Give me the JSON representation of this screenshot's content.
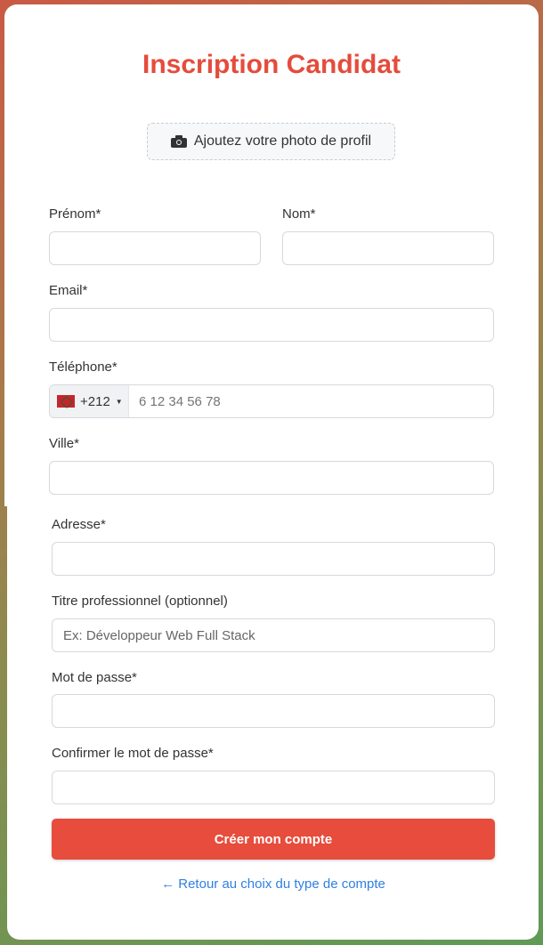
{
  "title": "Inscription Candidat",
  "photo_button": {
    "icon": "camera-icon",
    "label": "Ajoutez votre photo de profil"
  },
  "fields": {
    "prenom": {
      "label": "Prénom*",
      "value": ""
    },
    "nom": {
      "label": "Nom*",
      "value": ""
    },
    "email": {
      "label": "Email*",
      "value": ""
    },
    "telephone": {
      "label": "Téléphone*",
      "country_code": "+212",
      "placeholder": "6 12 34 56 78",
      "value": ""
    },
    "ville": {
      "label": "Ville*",
      "value": ""
    },
    "adresse": {
      "label": "Adresse*",
      "value": ""
    },
    "titre": {
      "label": "Titre professionnel (optionnel)",
      "placeholder": "Ex: Développeur Web Full Stack",
      "value": ""
    },
    "password": {
      "label": "Mot de passe*",
      "value": ""
    },
    "password_confirm": {
      "label": "Confirmer le mot de passe*",
      "value": ""
    }
  },
  "submit_label": "Créer mon compte",
  "back_link": "← Retour au choix du type de compte",
  "colors": {
    "accent": "#e74c3c",
    "link": "#2f7fe0"
  }
}
